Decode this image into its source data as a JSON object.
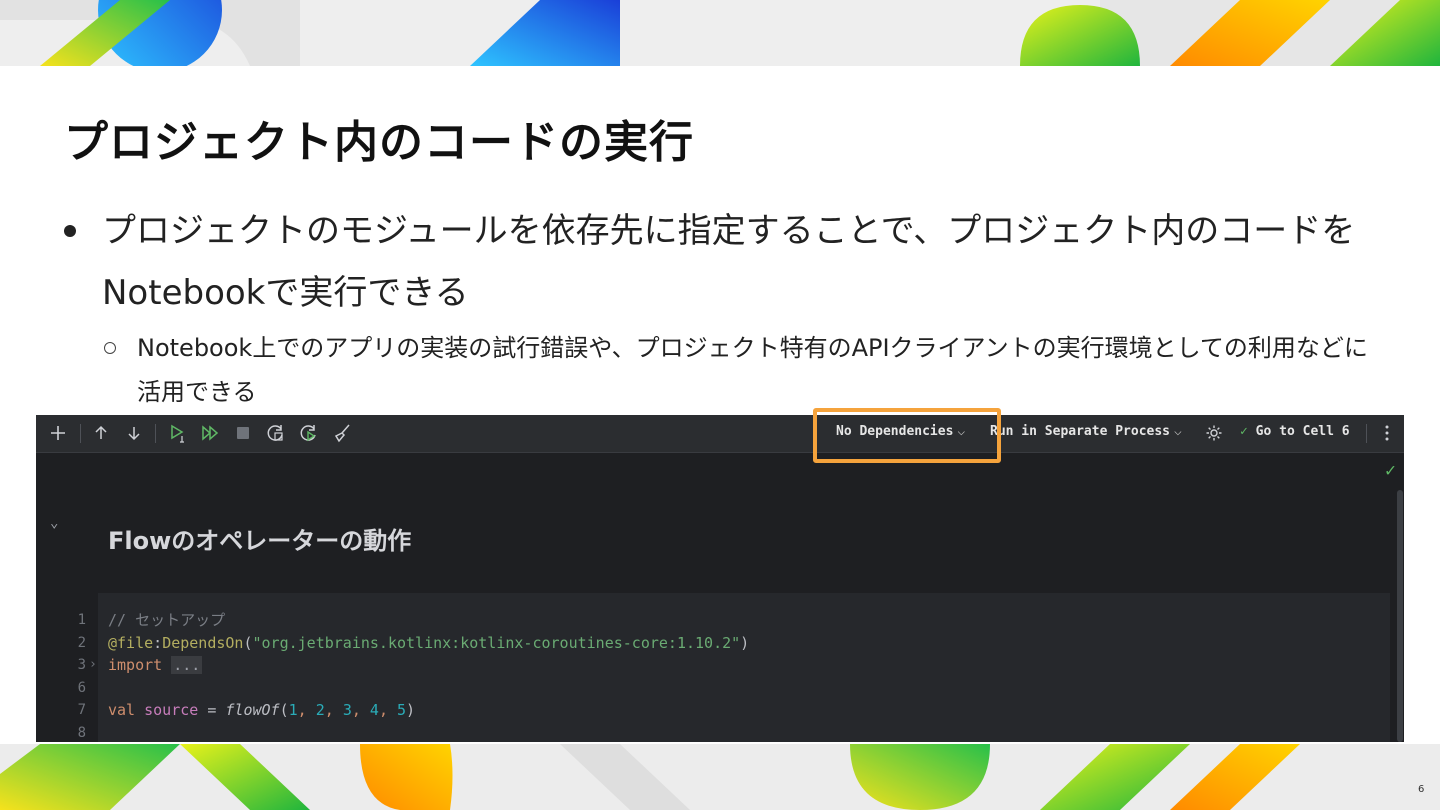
{
  "slide": {
    "title": "プロジェクト内のコードの実行",
    "bullet": "プロジェクトのモジュールを依存先に指定することで、プロジェクト内のコードをNotebookで実行できる",
    "sub_bullet": "Notebook上でのアプリの実装の試行錯誤や、プロジェクト特有のAPIクライアントの実行環境としての利用などに活用できる",
    "page_number": "6"
  },
  "toolbar": {
    "icons": [
      "add-icon",
      "arrow-up-icon",
      "arrow-down-icon",
      "run-cell-icon",
      "run-all-icon",
      "stop-icon",
      "restart-kernel-icon",
      "restart-run-all-icon",
      "clear-outputs-icon",
      "gear-icon",
      "kebab-menu-icon"
    ],
    "dependencies_label": "No Dependencies",
    "process_label": "Run in Separate Process",
    "goto_label": "Go to Cell 6",
    "check_color": "#5fb865",
    "highlight_color": "#f5a33c"
  },
  "notebook": {
    "markdown_heading": "Flowのオペレーターの動作",
    "code_lines": [
      {
        "number": "1",
        "parts": [
          {
            "text": "// セットアップ",
            "style": "comment"
          }
        ]
      },
      {
        "number": "2",
        "parts": [
          {
            "text": "@file",
            "style": "ann"
          },
          {
            "text": ":",
            "style": "plain"
          },
          {
            "text": "DependsOn",
            "style": "ann"
          },
          {
            "text": "(",
            "style": "plain"
          },
          {
            "text": "\"org.jetbrains.kotlinx:kotlinx-coroutines-core:1.10.2\"",
            "style": "str"
          },
          {
            "text": ")",
            "style": "plain"
          }
        ]
      },
      {
        "number": "3",
        "fold": "›",
        "parts": [
          {
            "text": "import",
            "style": "kw"
          },
          {
            "text": " ",
            "style": "plain"
          },
          {
            "text": "...",
            "style": "fold-box"
          }
        ]
      },
      {
        "number": "6",
        "parts": []
      },
      {
        "number": "7",
        "parts": [
          {
            "text": "val",
            "style": "kw"
          },
          {
            "text": " ",
            "style": "plain"
          },
          {
            "text": "source",
            "style": "var"
          },
          {
            "text": " = ",
            "style": "plain"
          },
          {
            "text": "flowOf",
            "style": "italic"
          },
          {
            "text": "(",
            "style": "plain"
          },
          {
            "text": "1",
            "style": "num"
          },
          {
            "text": ", ",
            "style": "kw"
          },
          {
            "text": "2",
            "style": "num"
          },
          {
            "text": ", ",
            "style": "kw"
          },
          {
            "text": "3",
            "style": "num"
          },
          {
            "text": ", ",
            "style": "kw"
          },
          {
            "text": "4",
            "style": "num"
          },
          {
            "text": ", ",
            "style": "kw"
          },
          {
            "text": "5",
            "style": "num"
          },
          {
            "text": ")",
            "style": "plain"
          }
        ]
      },
      {
        "number": "8",
        "parts": []
      }
    ]
  }
}
